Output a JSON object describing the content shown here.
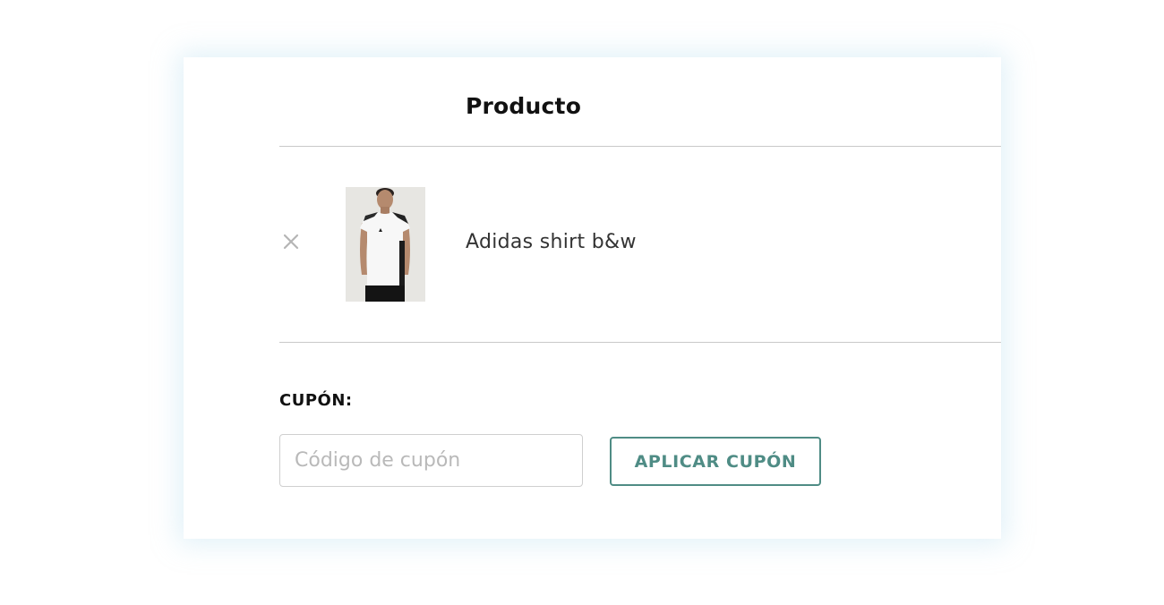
{
  "cart_table": {
    "product_header": "Producto"
  },
  "cart_items": [
    {
      "name": "Adidas shirt b&w",
      "thumbnail_icon": "product-thumbnail-white-shirt",
      "remove_icon": "close-icon"
    }
  ],
  "coupon": {
    "label": "CUPÓN:",
    "placeholder": "Código de cupón",
    "value": "",
    "apply_button_label": "APLICAR CUPÓN"
  },
  "colors": {
    "accent": "#4f8c85",
    "border": "#c9c9c9",
    "remove_icon": "#b5b5b5"
  }
}
